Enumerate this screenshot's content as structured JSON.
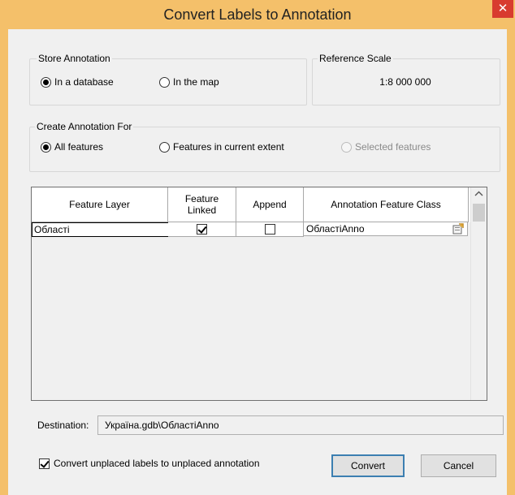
{
  "window": {
    "title": "Convert Labels to Annotation",
    "close_glyph": "✕"
  },
  "store_annotation": {
    "legend": "Store Annotation",
    "options": [
      {
        "label": "In a database",
        "selected": true
      },
      {
        "label": "In the map",
        "selected": false
      }
    ]
  },
  "reference_scale": {
    "legend": "Reference Scale",
    "value": "1:8 000 000"
  },
  "create_for": {
    "legend": "Create Annotation For",
    "options": [
      {
        "label": "All features",
        "selected": true,
        "enabled": true
      },
      {
        "label": "Features in current extent",
        "selected": false,
        "enabled": true
      },
      {
        "label": "Selected features",
        "selected": false,
        "enabled": false
      }
    ]
  },
  "table": {
    "columns": {
      "feature_layer": "Feature Layer",
      "feature_linked_1": "Feature",
      "feature_linked_2": "Linked",
      "append": "Append",
      "annotation_class": "Annotation Feature Class"
    },
    "rows": [
      {
        "feature_layer": "Області",
        "feature_linked": true,
        "append": false,
        "annotation_class": "ОбластіAnno"
      }
    ]
  },
  "destination": {
    "label": "Destination:",
    "value": "Україна.gdb\\ОбластіAnno"
  },
  "convert_unplaced": {
    "label": "Convert unplaced labels to unplaced annotation",
    "checked": true
  },
  "buttons": {
    "convert": "Convert",
    "cancel": "Cancel"
  },
  "icons": {
    "close": "close-icon",
    "properties": "properties-icon",
    "scroll_up": "chevron-up-icon"
  }
}
